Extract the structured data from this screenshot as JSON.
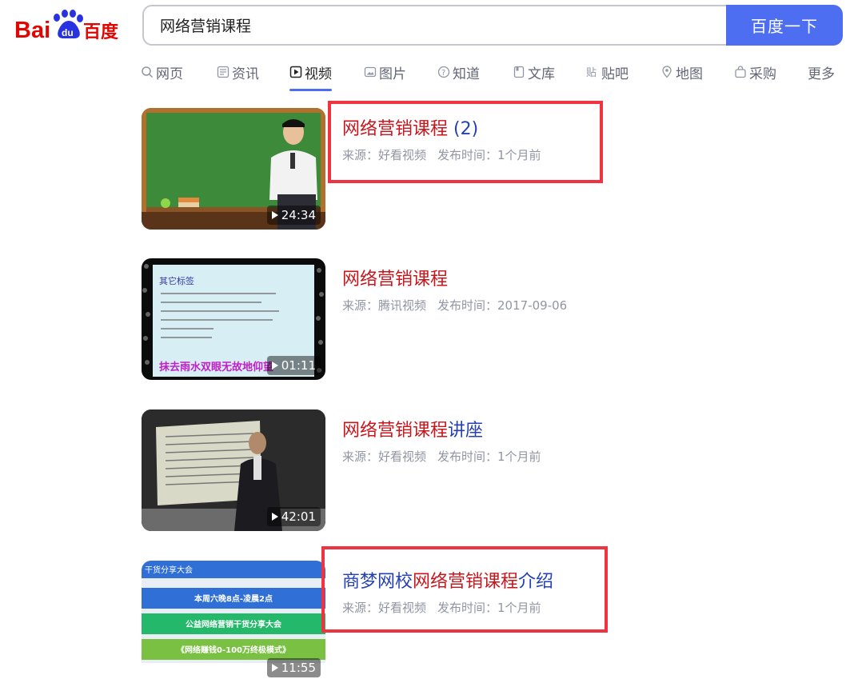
{
  "logo": {
    "text_left": "Bai",
    "text_paw": "du",
    "text_right": "百度"
  },
  "search": {
    "query": "网络营销课程",
    "button_label": "百度一下"
  },
  "tabs": [
    {
      "label": "网页",
      "icon": "search-icon"
    },
    {
      "label": "资讯",
      "icon": "news-icon"
    },
    {
      "label": "视频",
      "icon": "video-icon",
      "active": true
    },
    {
      "label": "图片",
      "icon": "image-icon"
    },
    {
      "label": "知道",
      "icon": "question-icon"
    },
    {
      "label": "文库",
      "icon": "document-icon"
    },
    {
      "label": "贴吧",
      "icon": "tieba-icon"
    },
    {
      "label": "地图",
      "icon": "map-icon"
    },
    {
      "label": "采购",
      "icon": "bag-icon"
    },
    {
      "label": "更多",
      "icon": ""
    }
  ],
  "results": [
    {
      "title_hl": "网络营销课程",
      "title_rest": " (2)",
      "source": "来源：好看视频",
      "published": "发布时间：1个月前",
      "duration": "24:34",
      "highlighted": true
    },
    {
      "title_hl": "网络营销课程",
      "title_rest": "",
      "source": "来源：腾讯视频",
      "published": "发布时间：2017-09-06",
      "duration": "01:11",
      "highlighted": false,
      "thumb_text": {
        "heading": "其它标签",
        "caption": "抹去雨水双眼无故地仰望"
      }
    },
    {
      "title_hl": "网络营销课程",
      "title_rest": "讲座",
      "source": "来源：好看视频",
      "published": "发布时间：1个月前",
      "duration": "42:01",
      "highlighted": false
    },
    {
      "title_pre": "商梦网校",
      "title_hl": "网络营销课程",
      "title_rest": "介绍",
      "source": "来源：好看视频",
      "published": "发布时间：1个月前",
      "duration": "11:55",
      "highlighted": true,
      "thumb_text": {
        "banner": "干货分享大会",
        "line1": "本周六晚8点-凌晨2点",
        "line2": "公益网络营销干货分享大会",
        "line3": "《网络赚钱0-100万终极模式》"
      }
    }
  ],
  "colors": {
    "accent": "#4e6ef2",
    "highlight": "#c8161d",
    "link": "#2440b3",
    "annotation": "#ef3340"
  }
}
